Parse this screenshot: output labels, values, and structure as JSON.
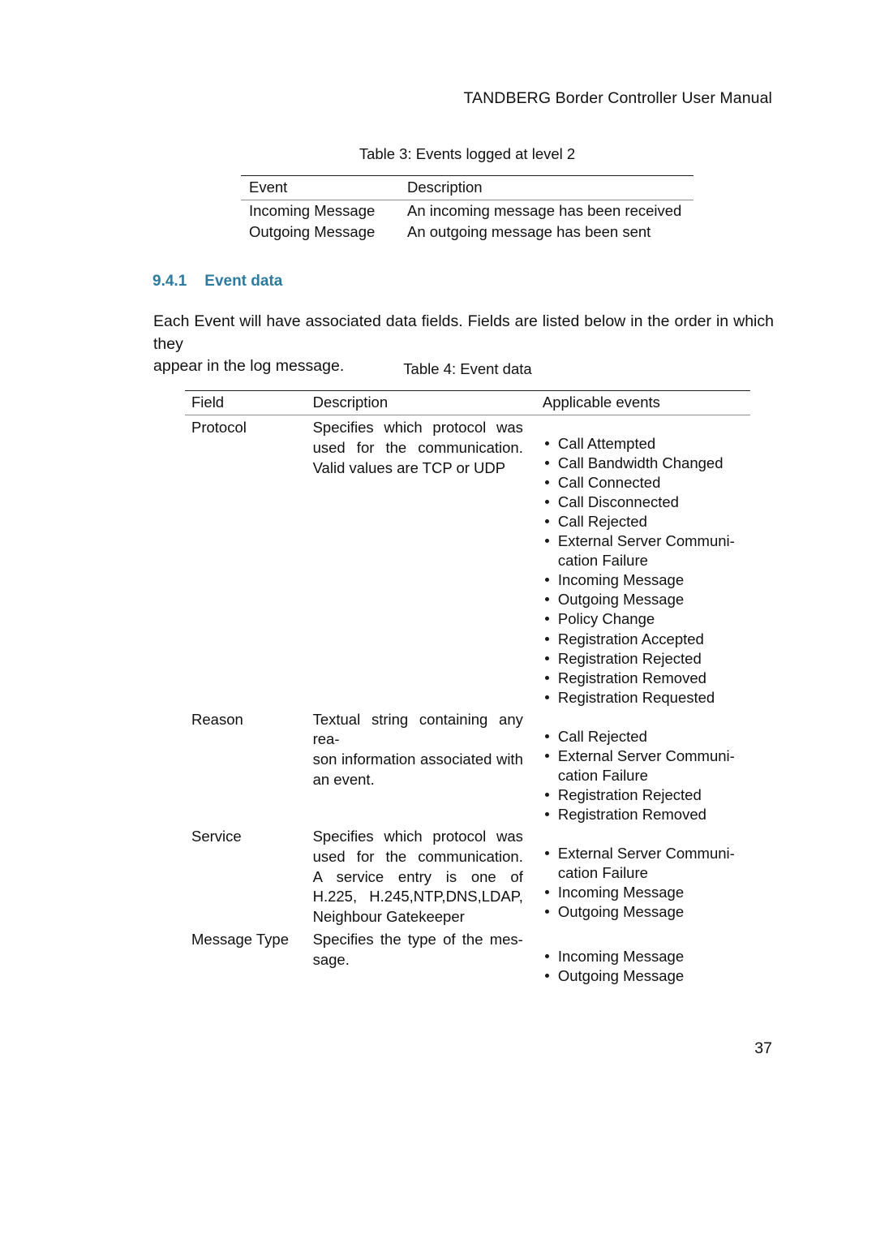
{
  "header": {
    "running_title": "TANDBERG Border Controller User Manual"
  },
  "table3": {
    "caption": "Table 3: Events logged at level 2",
    "columns": [
      "Event",
      "Description"
    ],
    "rows": [
      [
        "Incoming Message",
        "An incoming message has been received"
      ],
      [
        "Outgoing Message",
        "An outgoing message has been sent"
      ]
    ]
  },
  "section": {
    "number": "9.4.1",
    "title": "Event data",
    "heading_color": "#2d7b9e",
    "paragraph_line1": "Each Event will have associated data fields. Fields are listed below in the order in which they",
    "paragraph_line2": "appear in the log message."
  },
  "table4": {
    "caption": "Table 4: Event data",
    "columns": [
      "Field",
      "Description",
      "Applicable events"
    ],
    "rows": [
      {
        "field": "Protocol",
        "description_lines": [
          "Specifies which protocol was",
          "used for the communication.",
          "Valid values are TCP or UDP"
        ],
        "applicable_events": [
          "Call Attempted",
          "Call Bandwidth Changed",
          "Call Connected",
          "Call Disconnected",
          "Call Rejected",
          "External Server Communi-\ncation Failure",
          "Incoming Message",
          "Outgoing Message",
          "Policy Change",
          "Registration Accepted",
          "Registration Rejected",
          "Registration Removed",
          "Registration Requested"
        ]
      },
      {
        "field": "Reason",
        "description_lines": [
          "Textual string containing any rea-",
          "son information associated with",
          "an event."
        ],
        "applicable_events": [
          "Call Rejected",
          "External Server Communi-\ncation Failure",
          "Registration Rejected",
          "Registration Removed"
        ]
      },
      {
        "field": "Service",
        "description_lines": [
          "Specifies which protocol was",
          "used for the communication.",
          "A service entry is one of",
          "H.225, H.245,NTP,DNS,LDAP,",
          "Neighbour Gatekeeper"
        ],
        "applicable_events": [
          "External Server Communi-\ncation Failure",
          "Incoming Message",
          "Outgoing Message"
        ]
      },
      {
        "field": "Message Type",
        "description_lines": [
          "Specifies the type of the mes-",
          "sage."
        ],
        "applicable_events": [
          "Incoming Message",
          "Outgoing Message"
        ]
      }
    ]
  },
  "footer": {
    "page_number": "37"
  }
}
